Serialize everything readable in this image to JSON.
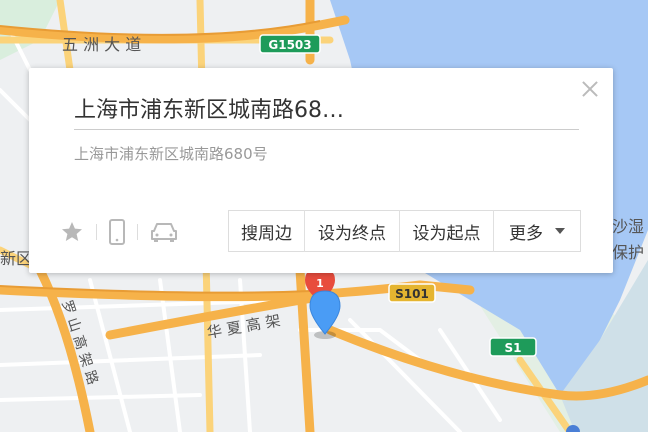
{
  "map": {
    "labels": {
      "road_wuzhou": "五 洲 大 道",
      "road_huaxia": "华 夏 高 架",
      "road_luoshan": "罗 山 高 架 路",
      "district_left": "新区",
      "edge_right_1": "沙湿",
      "edge_right_2": "保护"
    },
    "shields": {
      "g1503": "G1503",
      "s101": "S101",
      "s1": "S1"
    },
    "marker_badge": "1",
    "colors": {
      "water": "#a6c8f5",
      "land": "#eef0f2",
      "highway": "#f6b24a",
      "major_road": "#fbd37a",
      "shield_green": "#1e9b5a",
      "shield_yellow": "#e5b530",
      "marker_blue": "#4a9cf5",
      "marker_red": "#e84c3d"
    }
  },
  "popup": {
    "title": "上海市浦东新区城南路68…",
    "address": "上海市浦东新区城南路680号",
    "icons": [
      "star-icon",
      "phone-icon",
      "car-icon"
    ],
    "actions": {
      "nearby": "搜周边",
      "set_end": "设为终点",
      "set_start": "设为起点",
      "more": "更多"
    }
  }
}
